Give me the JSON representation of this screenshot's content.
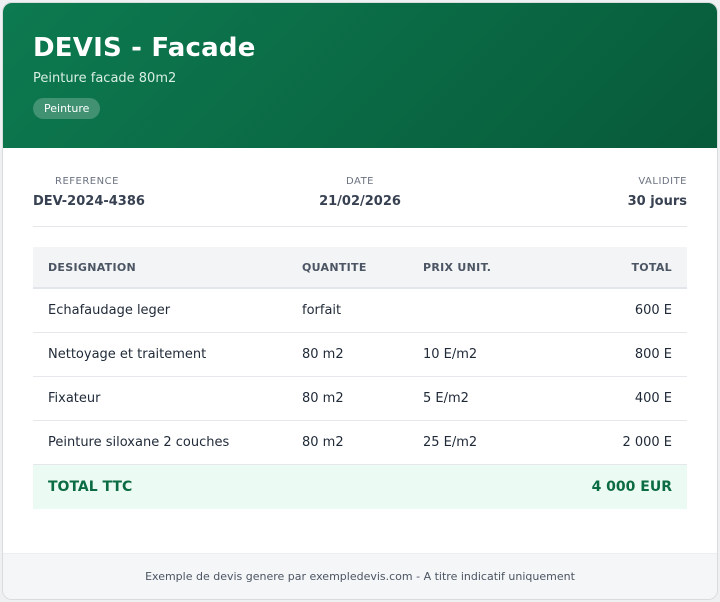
{
  "header": {
    "title": "DEVIS - Facade",
    "subtitle": "Peinture facade 80m2",
    "badge": "Peinture"
  },
  "meta": {
    "reference_label": "REFERENCE",
    "reference_value": "DEV-2024-4386",
    "date_label": "DATE",
    "date_value": "21/02/2026",
    "validity_label": "VALIDITE",
    "validity_value": "30 jours"
  },
  "table": {
    "columns": [
      "DESIGNATION",
      "QUANTITE",
      "PRIX UNIT.",
      "TOTAL"
    ],
    "rows": [
      [
        "Echafaudage leger",
        "forfait",
        "",
        "600 E"
      ],
      [
        "Nettoyage et traitement",
        "80 m2",
        "10 E/m2",
        "800 E"
      ],
      [
        "Fixateur",
        "80 m2",
        "5 E/m2",
        "400 E"
      ],
      [
        "Peinture siloxane 2 couches",
        "80 m2",
        "25 E/m2",
        "2 000 E"
      ]
    ],
    "total_label": "TOTAL TTC",
    "total_value": "4 000 EUR"
  },
  "footer": {
    "text": "Exemple de devis genere par exempledevis.com - A titre indicatif uniquement"
  },
  "colors": {
    "brand_green": "#0a6944",
    "total_bg": "#ebfaf2",
    "total_text": "#0b6b43"
  }
}
